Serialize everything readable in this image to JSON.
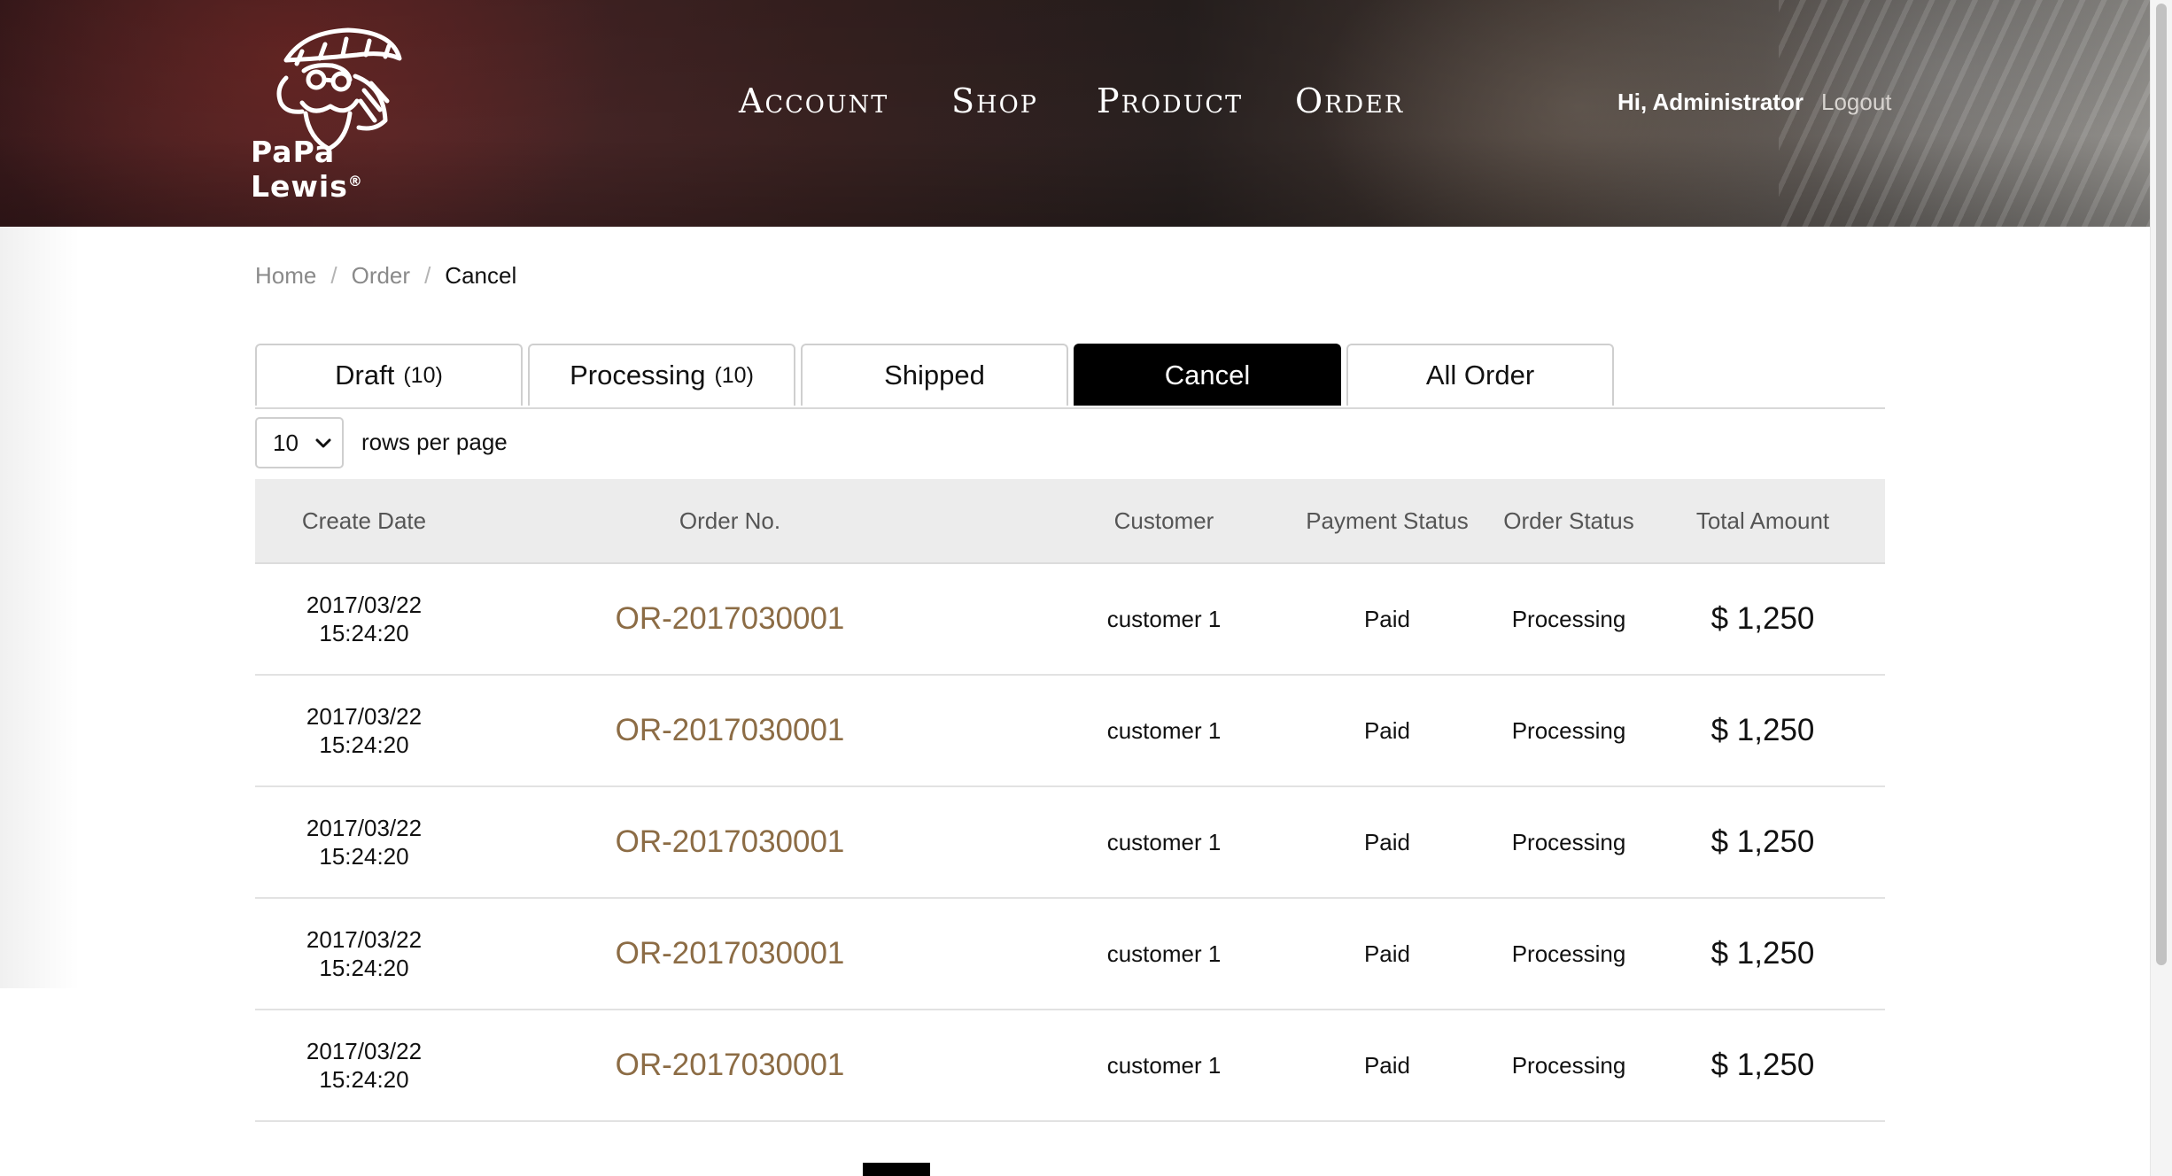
{
  "brand": {
    "name": "PaPa Lewis",
    "registered": "®"
  },
  "nav": {
    "items": [
      {
        "label": "Account"
      },
      {
        "label": "Shop"
      },
      {
        "label": "Product"
      },
      {
        "label": "Order"
      }
    ],
    "greeting": "Hi, Administrator",
    "logout": "Logout"
  },
  "breadcrumb": {
    "items": [
      "Home",
      "Order",
      "Cancel"
    ],
    "separator": "/"
  },
  "tabs": [
    {
      "label": "Draft",
      "count": "(10)"
    },
    {
      "label": "Processing",
      "count": "(10)"
    },
    {
      "label": "Shipped",
      "count": ""
    },
    {
      "label": "Cancel",
      "count": "",
      "active": true
    },
    {
      "label": "All Order",
      "count": ""
    }
  ],
  "pager": {
    "rows_per_page_value": "10",
    "rows_per_page_label": "rows per page"
  },
  "table": {
    "columns": [
      "Create Date",
      "Order No.",
      "Customer",
      "Payment Status",
      "Order Status",
      "Total Amount"
    ],
    "rows": [
      {
        "date": "2017/03/22",
        "time": "15:24:20",
        "order_no": "OR-2017030001",
        "customer": "customer 1",
        "payment": "Paid",
        "status": "Processing",
        "amount": "$ 1,250"
      },
      {
        "date": "2017/03/22",
        "time": "15:24:20",
        "order_no": "OR-2017030001",
        "customer": "customer 1",
        "payment": "Paid",
        "status": "Processing",
        "amount": "$ 1,250"
      },
      {
        "date": "2017/03/22",
        "time": "15:24:20",
        "order_no": "OR-2017030001",
        "customer": "customer 1",
        "payment": "Paid",
        "status": "Processing",
        "amount": "$ 1,250"
      },
      {
        "date": "2017/03/22",
        "time": "15:24:20",
        "order_no": "OR-2017030001",
        "customer": "customer 1",
        "payment": "Paid",
        "status": "Processing",
        "amount": "$ 1,250"
      },
      {
        "date": "2017/03/22",
        "time": "15:24:20",
        "order_no": "OR-2017030001",
        "customer": "customer 1",
        "payment": "Paid",
        "status": "Processing",
        "amount": "$ 1,250"
      }
    ]
  },
  "colors": {
    "accent_link": "#8c6c45",
    "active_tab": "#000000",
    "header_row": "#ececec"
  },
  "icons": {
    "logo": "papa-lewis-mascot-icon",
    "select": "chevron-down-icon"
  }
}
